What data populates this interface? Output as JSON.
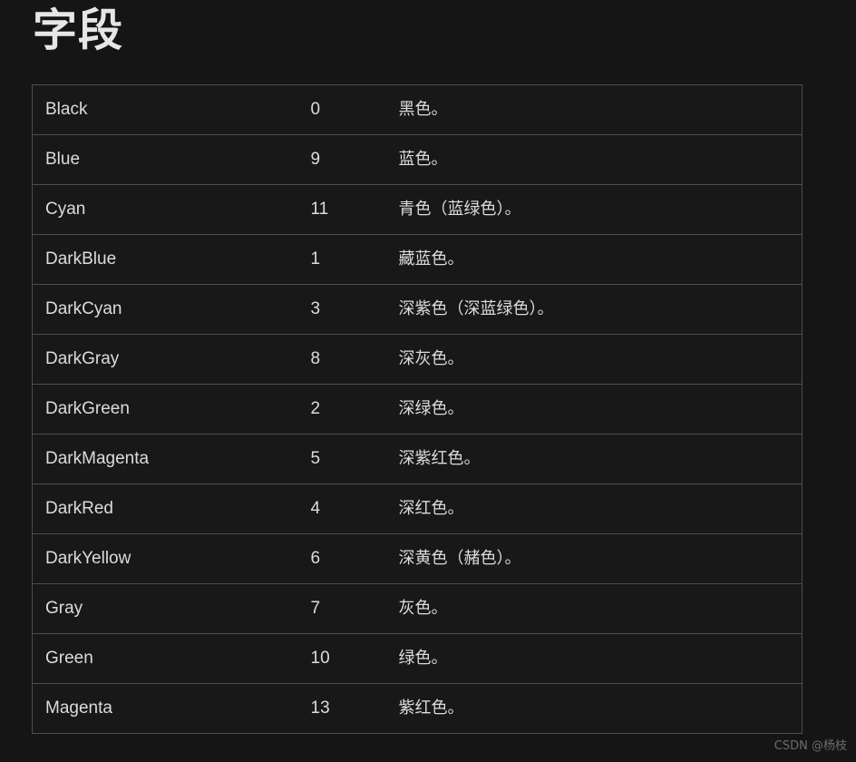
{
  "page": {
    "title": "字段",
    "background_color": "#151515",
    "text_color": "#dcdcdc",
    "border_color": "#4d4d4d",
    "cell_background": "#181818"
  },
  "table": {
    "rows": [
      {
        "name": "Black",
        "value": "0",
        "description": "黑色。"
      },
      {
        "name": "Blue",
        "value": "9",
        "description": "蓝色。"
      },
      {
        "name": "Cyan",
        "value": "11",
        "description": "青色（蓝绿色）。"
      },
      {
        "name": "DarkBlue",
        "value": "1",
        "description": "藏蓝色。"
      },
      {
        "name": "DarkCyan",
        "value": "3",
        "description": "深紫色（深蓝绿色）。"
      },
      {
        "name": "DarkGray",
        "value": "8",
        "description": "深灰色。"
      },
      {
        "name": "DarkGreen",
        "value": "2",
        "description": "深绿色。"
      },
      {
        "name": "DarkMagenta",
        "value": "5",
        "description": "深紫红色。"
      },
      {
        "name": "DarkRed",
        "value": "4",
        "description": "深红色。"
      },
      {
        "name": "DarkYellow",
        "value": "6",
        "description": "深黄色（赭色）。"
      },
      {
        "name": "Gray",
        "value": "7",
        "description": "灰色。"
      },
      {
        "name": "Green",
        "value": "10",
        "description": "绿色。"
      },
      {
        "name": "Magenta",
        "value": "13",
        "description": "紫红色。"
      }
    ]
  },
  "watermark": {
    "text": "CSDN @杨枝"
  }
}
